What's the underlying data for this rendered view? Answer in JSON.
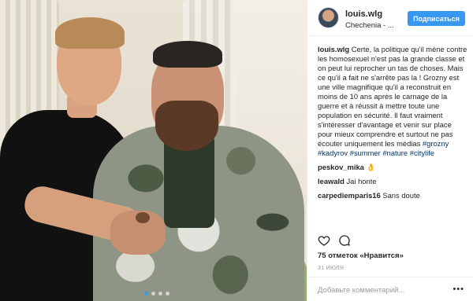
{
  "header": {
    "username": "louis.wlg",
    "location": "Chechenia - ...",
    "follow_label": "Подписаться"
  },
  "caption": {
    "username": "louis.wlg",
    "text": "Certe, la politique qu'il mène contre les homosexuel n'est pas la grande classe et on peut lui reprocher un tas de choses. Mais ce qu'il a fait ne s'arrête pas la ! Grozny est une ville magnifique qu'il a reconstruit en moins de 10 ans après le carnage de la guerre et à réussit à mettre toute une population en sécurité. Il faut vraiment s'intéresser d'avantage et venir sur place pour mieux comprendre et surtout ne pas écouter uniquement les médias",
    "tags": [
      "#grozny",
      "#kadyrov",
      "#summer",
      "#nature",
      "#citylife"
    ]
  },
  "comments": [
    {
      "username": "peskov_mika",
      "text": "👌"
    },
    {
      "username": "leawald",
      "text": "Jai honte"
    },
    {
      "username": "carpediemparis16",
      "text": "Sans doute"
    }
  ],
  "likes": "75 отметок «Нравится»",
  "date": "31 ИЮЛЯ",
  "add_comment_placeholder": "Добавьте комментарий...",
  "more_label": "•••",
  "carousel": {
    "count": 4,
    "active": 0
  },
  "colors": {
    "accent": "#3897f0",
    "tag": "#003569",
    "muted": "#999999"
  },
  "icons": {
    "like": "heart-icon",
    "comment": "comment-icon",
    "more": "more-options-icon"
  }
}
